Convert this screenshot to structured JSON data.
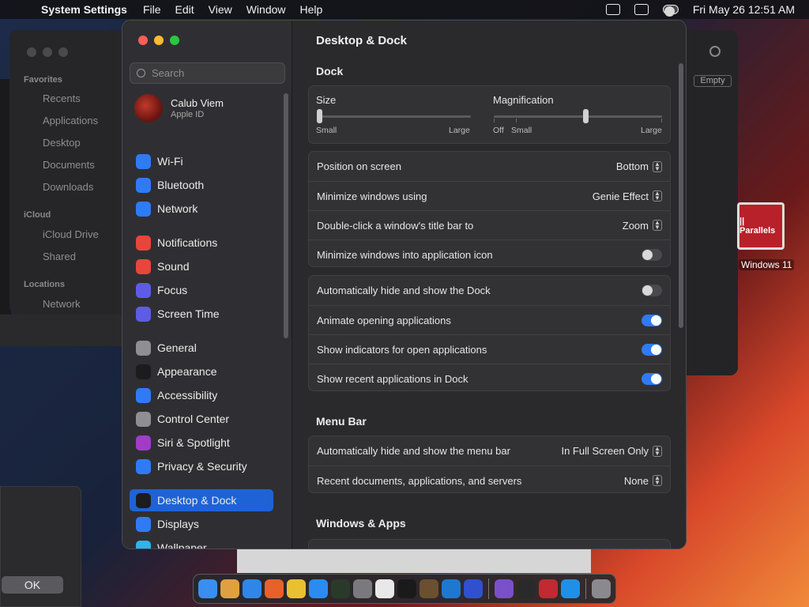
{
  "menubar": {
    "app": "System Settings",
    "menus": [
      "File",
      "Edit",
      "View",
      "Window",
      "Help"
    ],
    "datetime": "Fri May 26  12:51 AM"
  },
  "finder": {
    "favorites_label": "Favorites",
    "favorites": [
      "Recents",
      "Applications",
      "Desktop",
      "Documents",
      "Downloads"
    ],
    "icloud_label": "iCloud",
    "icloud": [
      "iCloud Drive",
      "Shared"
    ],
    "locations_label": "Locations",
    "locations": [
      "Network"
    ]
  },
  "background": {
    "ok_label": "OK",
    "empty_label": "Empty",
    "parallels_logo": "|| Parallels",
    "parallels_caption": "Windows 11"
  },
  "sidebar": {
    "search_placeholder": "Search",
    "account": {
      "name": "Calub Viem",
      "sub": "Apple ID"
    },
    "items": [
      {
        "label": "Wi-Fi",
        "icon": "wifi-icon",
        "color": "#2f7bf5"
      },
      {
        "label": "Bluetooth",
        "icon": "bluetooth-icon",
        "color": "#2f7bf5"
      },
      {
        "label": "Network",
        "icon": "globe-icon",
        "color": "#2f7bf5"
      },
      {
        "label": "Notifications",
        "icon": "bell-icon",
        "color": "#e8453c"
      },
      {
        "label": "Sound",
        "icon": "speaker-icon",
        "color": "#e8453c"
      },
      {
        "label": "Focus",
        "icon": "moon-icon",
        "color": "#5e5ce6"
      },
      {
        "label": "Screen Time",
        "icon": "hourglass-icon",
        "color": "#5e5ce6"
      },
      {
        "label": "General",
        "icon": "gear-icon",
        "color": "#8e8e93"
      },
      {
        "label": "Appearance",
        "icon": "appearance-icon",
        "color": "#1c1c1e"
      },
      {
        "label": "Accessibility",
        "icon": "accessibility-icon",
        "color": "#2f7bf5"
      },
      {
        "label": "Control Center",
        "icon": "control-center-icon",
        "color": "#8e8e93"
      },
      {
        "label": "Siri & Spotlight",
        "icon": "siri-icon",
        "color": "#a03cc8"
      },
      {
        "label": "Privacy & Security",
        "icon": "hand-icon",
        "color": "#2f7bf5"
      },
      {
        "label": "Desktop & Dock",
        "icon": "dock-icon",
        "color": "#1c1c1e"
      },
      {
        "label": "Displays",
        "icon": "sun-icon",
        "color": "#2f7bf5"
      },
      {
        "label": "Wallpaper",
        "icon": "wallpaper-icon",
        "color": "#2fb5e8"
      }
    ]
  },
  "content": {
    "title": "Desktop & Dock",
    "dock_heading": "Dock",
    "size": {
      "label": "Size",
      "min": "Small",
      "max": "Large",
      "value": 0
    },
    "magnification": {
      "label": "Magnification",
      "off": "Off",
      "min": "Small",
      "max": "Large",
      "value": 0.55
    },
    "dock_settings": [
      {
        "label": "Position on screen",
        "value": "Bottom"
      },
      {
        "label": "Minimize windows using",
        "value": "Genie Effect"
      },
      {
        "label": "Double-click a window's title bar to",
        "value": "Zoom"
      },
      {
        "label": "Minimize windows into application icon",
        "toggle": false
      }
    ],
    "dock_toggles": [
      {
        "label": "Automatically hide and show the Dock",
        "toggle": false
      },
      {
        "label": "Animate opening applications",
        "toggle": true
      },
      {
        "label": "Show indicators for open applications",
        "toggle": true
      },
      {
        "label": "Show recent applications in Dock",
        "toggle": true
      }
    ],
    "menubar_heading": "Menu Bar",
    "menubar_settings": [
      {
        "label": "Automatically hide and show the menu bar",
        "value": "In Full Screen Only"
      },
      {
        "label": "Recent documents, applications, and servers",
        "value": "None"
      }
    ],
    "windows_heading": "Windows & Apps"
  },
  "dock": {
    "icons": [
      {
        "name": "finder-icon",
        "color": "#3a8ef0"
      },
      {
        "name": "launchpad-icon",
        "color": "#e0a040"
      },
      {
        "name": "safari-icon",
        "color": "#2f86e8"
      },
      {
        "name": "firefox-icon",
        "color": "#e8602a"
      },
      {
        "name": "chrome-icon",
        "color": "#e8c030"
      },
      {
        "name": "app-store-icon",
        "color": "#2a8cf0"
      },
      {
        "name": "terminal-like-icon",
        "color": "#2a3a2a"
      },
      {
        "name": "system-settings-icon",
        "color": "#7a7a7e"
      },
      {
        "name": "textedit-icon",
        "color": "#e8e8e8"
      },
      {
        "name": "terminal-icon",
        "color": "#1a1a1a"
      },
      {
        "name": "brush-icon",
        "color": "#6a5030"
      },
      {
        "name": "vscode-icon",
        "color": "#1e78d0"
      },
      {
        "name": "blue-square-icon",
        "color": "#3050d0"
      },
      {
        "name": "visual-studio-icon",
        "color": "#7a50c8"
      },
      {
        "name": "activity-monitor-icon",
        "color": "#2a2a2a"
      },
      {
        "name": "parallels-icon",
        "color": "#c02a30"
      },
      {
        "name": "windows-icon",
        "color": "#1e90e8"
      },
      {
        "name": "trash-icon",
        "color": "#8a8a8e"
      }
    ]
  }
}
